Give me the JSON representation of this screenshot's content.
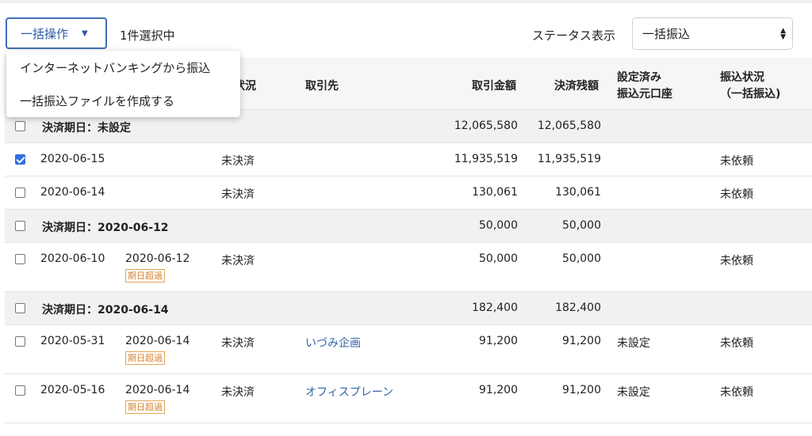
{
  "toolbar": {
    "bulk_button_label": "一括操作",
    "selection_count": "1件選択中",
    "status_label": "ステータス表示",
    "status_value": "一括振込"
  },
  "menu": {
    "items": [
      "インターネットバンキングから振込",
      "一括振込ファイルを作成する"
    ]
  },
  "headers": {
    "status": "済状況",
    "partner": "取引先",
    "amount": "取引金額",
    "balance": "決済残額",
    "account_line1": "設定済み",
    "account_line2": "振込元口座",
    "transfer_line1": "振込状況",
    "transfer_line2": "（一括振込)"
  },
  "rows": [
    {
      "type": "group",
      "label": "決済期日：未設定",
      "amount": "12,065,580",
      "balance": "12,065,580"
    },
    {
      "type": "item",
      "checked": true,
      "date": "2020-06-15",
      "due": "",
      "badge": "",
      "status": "未決済",
      "partner": "",
      "amount": "11,935,519",
      "balance": "11,935,519",
      "account": "",
      "transfer": "未依頼"
    },
    {
      "type": "item",
      "checked": false,
      "date": "2020-06-14",
      "due": "",
      "badge": "",
      "status": "未決済",
      "partner": "",
      "amount": "130,061",
      "balance": "130,061",
      "account": "",
      "transfer": "未依頼"
    },
    {
      "type": "group",
      "label": "決済期日：2020-06-12",
      "amount": "50,000",
      "balance": "50,000"
    },
    {
      "type": "item",
      "checked": false,
      "date": "2020-06-10",
      "due": "2020-06-12",
      "badge": "期日超過",
      "status": "未決済",
      "partner": "",
      "amount": "50,000",
      "balance": "50,000",
      "account": "",
      "transfer": "未依頼"
    },
    {
      "type": "group",
      "label": "決済期日：2020-06-14",
      "amount": "182,400",
      "balance": "182,400"
    },
    {
      "type": "item",
      "checked": false,
      "date": "2020-05-31",
      "due": "2020-06-14",
      "badge": "期日超過",
      "status": "未決済",
      "partner": "いづみ企画",
      "amount": "91,200",
      "balance": "91,200",
      "account": "未設定",
      "transfer": "未依頼"
    },
    {
      "type": "item",
      "checked": false,
      "date": "2020-05-16",
      "due": "2020-06-14",
      "badge": "期日超過",
      "status": "未決済",
      "partner": "オフィスプレーン",
      "amount": "91,200",
      "balance": "91,200",
      "account": "未設定",
      "transfer": "未依頼"
    }
  ],
  "colors": {
    "accent": "#3f6db4",
    "link": "#3465a8",
    "checkbox_checked": "#2f6fdf",
    "overdue_badge": "#d5822b",
    "group_row_bg": "#f1f1f1",
    "header_bg": "#f6f6f6"
  }
}
